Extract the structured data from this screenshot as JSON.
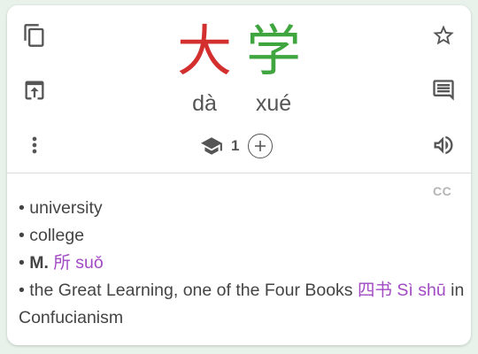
{
  "entry": {
    "characters": [
      {
        "hanzi": "大",
        "pinyin": "dà",
        "color": "#d32f2f"
      },
      {
        "hanzi": "学",
        "pinyin": "xué",
        "color": "#3fa53f"
      }
    ],
    "level": "1",
    "source_badge": "CC"
  },
  "definitions": {
    "line1": "university",
    "line2": "college",
    "line3_label": "M.",
    "line3_link": "所 suǒ",
    "line4_text": "the Great Learning, one of the Four Books",
    "line4_link": "四书 Sì shū",
    "line4_tail": "in Confucianism",
    "bullet": "•"
  },
  "icons": {
    "copy": "copy-icon",
    "share": "open-in-icon",
    "more": "more-vert-icon",
    "star": "star-outline-icon",
    "comment": "comment-icon",
    "audio": "volume-icon",
    "level": "school-cap-icon",
    "add": "add-circle-icon"
  },
  "colors": {
    "accent_link": "#a24ac4",
    "tone4": "#d32f2f",
    "tone2": "#3fa53f"
  }
}
